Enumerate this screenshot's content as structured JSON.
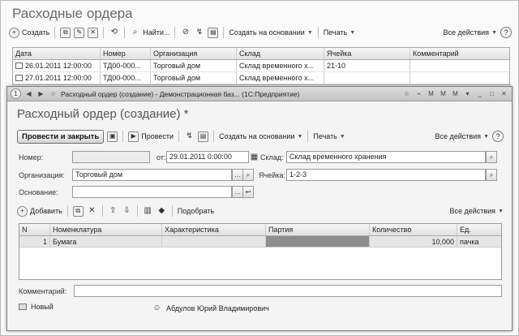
{
  "list_window": {
    "title": "Расходные ордера",
    "toolbar": {
      "create": "Создать",
      "find": "Найти...",
      "create_based": "Создать на основании",
      "print": "Печать",
      "all_actions": "Все действия"
    },
    "columns": [
      "Дата",
      "Номер",
      "Организация",
      "Склад",
      "Ячейка",
      "Комментарий"
    ],
    "rows": [
      {
        "date": "26.01.2011 12:00:00",
        "number": "ТД00-000...",
        "org": "Торговый дом",
        "warehouse": "Склад временного х...",
        "cell": "21-10",
        "comment": ""
      },
      {
        "date": "27.01.2011 12:00:00",
        "number": "ТД00-000...",
        "org": "Торговый дом",
        "warehouse": "Склад временного х...",
        "cell": "",
        "comment": ""
      }
    ]
  },
  "doc_window": {
    "titlebar": "Расходный ордер (создание) - Демонстрационная баз... (1С:Предприятие)",
    "heading": "Расходный ордер (создание) *",
    "toolbar": {
      "post_close": "Провести и закрыть",
      "post": "Провести",
      "create_based": "Создать на основании",
      "print": "Печать",
      "all_actions": "Все действия"
    },
    "fields": {
      "number_label": "Номер:",
      "number_value": "",
      "date_label": "от:",
      "date_value": "29.01.2011  0:00:00",
      "warehouse_label": "Склад:",
      "warehouse_value": "Склад временного хранения",
      "org_label": "Организация:",
      "org_value": "Торговый дом",
      "cell_label": "Ячейка:",
      "cell_value": "1-2-3",
      "basis_label": "Основание:",
      "basis_value": ""
    },
    "table_toolbar": {
      "add": "Добавить",
      "pick": "Подобрать",
      "all_actions": "Все действия"
    },
    "table": {
      "columns": [
        "N",
        "Номенклатура",
        "Характеристика",
        "Партия",
        "Количество",
        "Ед."
      ],
      "rows": [
        {
          "n": "1",
          "item": "Бумага",
          "characteristic": "",
          "batch": "",
          "qty": "10,000",
          "unit": "пачка"
        }
      ]
    },
    "comment_label": "Комментарий:",
    "comment_value": "",
    "status": "Новый",
    "author": "Абдулов Юрий Владимирович"
  },
  "colors": {
    "window_bg": "#f4f4f4",
    "selected_row": "#e6e6e6",
    "batch_cell": "#8d8d8d"
  }
}
